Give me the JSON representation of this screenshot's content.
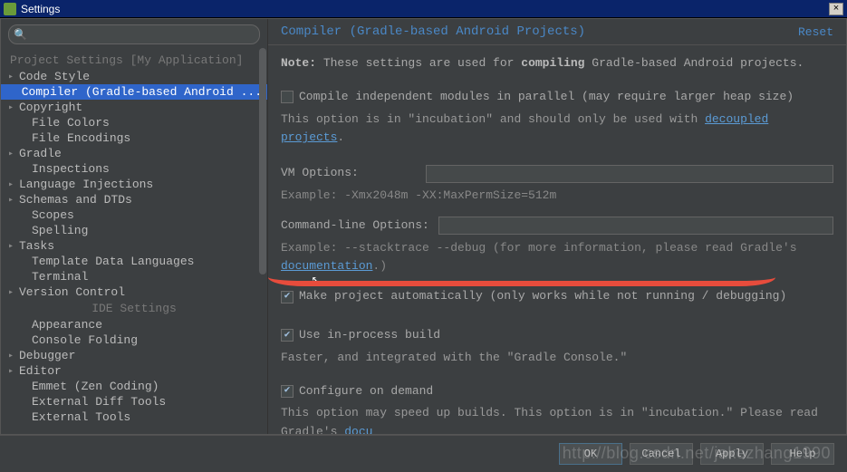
{
  "window": {
    "title": "Settings",
    "close": "×"
  },
  "search": {
    "placeholder": ""
  },
  "tree": {
    "section1": "Project Settings [My Application]",
    "items1": [
      {
        "label": "Code Style",
        "expandable": true
      },
      {
        "label": "Compiler (Gradle-based Android ...",
        "expandable": false,
        "selected": true,
        "indent": true
      },
      {
        "label": "Copyright",
        "expandable": true
      },
      {
        "label": "File Colors",
        "expandable": false,
        "indent": true
      },
      {
        "label": "File Encodings",
        "expandable": false,
        "indent": true
      },
      {
        "label": "Gradle",
        "expandable": true
      },
      {
        "label": "Inspections",
        "expandable": false,
        "indent": true
      },
      {
        "label": "Language Injections",
        "expandable": true
      },
      {
        "label": "Schemas and DTDs",
        "expandable": true
      },
      {
        "label": "Scopes",
        "expandable": false,
        "indent": true
      },
      {
        "label": "Spelling",
        "expandable": false,
        "indent": true
      },
      {
        "label": "Tasks",
        "expandable": true
      },
      {
        "label": "Template Data Languages",
        "expandable": false,
        "indent": true
      },
      {
        "label": "Terminal",
        "expandable": false,
        "indent": true
      },
      {
        "label": "Version Control",
        "expandable": true
      }
    ],
    "section2": "IDE Settings",
    "items2": [
      {
        "label": "Appearance",
        "expandable": false,
        "indent": true
      },
      {
        "label": "Console Folding",
        "expandable": false,
        "indent": true
      },
      {
        "label": "Debugger",
        "expandable": true
      },
      {
        "label": "Editor",
        "expandable": true
      },
      {
        "label": "Emmet (Zen Coding)",
        "expandable": false,
        "indent": true
      },
      {
        "label": "External Diff Tools",
        "expandable": false,
        "indent": true
      },
      {
        "label": "External Tools",
        "expandable": false,
        "indent": true
      }
    ]
  },
  "panel": {
    "title": "Compiler (Gradle-based Android Projects)",
    "reset": "Reset",
    "note_prefix": "Note:",
    "note_text1": " These settings are used for ",
    "note_bold": "compiling",
    "note_text2": " Gradle-based Android projects.",
    "cb_parallel": "Compile independent modules in parallel (may require larger heap size)",
    "incubation1a": "This option is in \"incubation\" and should only be used with ",
    "incubation1_link": "decoupled projects",
    "incubation1b": ".",
    "vm_label": "VM Options:",
    "vm_value": "",
    "vm_example": "Example: -Xmx2048m -XX:MaxPermSize=512m",
    "cmd_label": "Command-line Options:",
    "cmd_value": "",
    "cmd_example_a": "Example: --stacktrace --debug (for more information, please read Gradle's ",
    "cmd_example_link": "documentation",
    "cmd_example_b": ".)",
    "cb_make": "Make project automatically (only works while not running / debugging)",
    "cb_inproc": "Use in-process build",
    "inproc_sub": "Faster, and integrated with the \"Gradle Console.\"",
    "cb_ondemand": "Configure on demand",
    "ondemand_sub_a": "This option may speed up builds. This option is in \"incubation.\" Please read Gradle's ",
    "ondemand_link": "docu"
  },
  "buttons": {
    "ok": "OK",
    "cancel": "Cancel",
    "apply": "Apply",
    "help": "Help"
  },
  "watermark": "http://blog.csdn.net/jakezhang1990"
}
